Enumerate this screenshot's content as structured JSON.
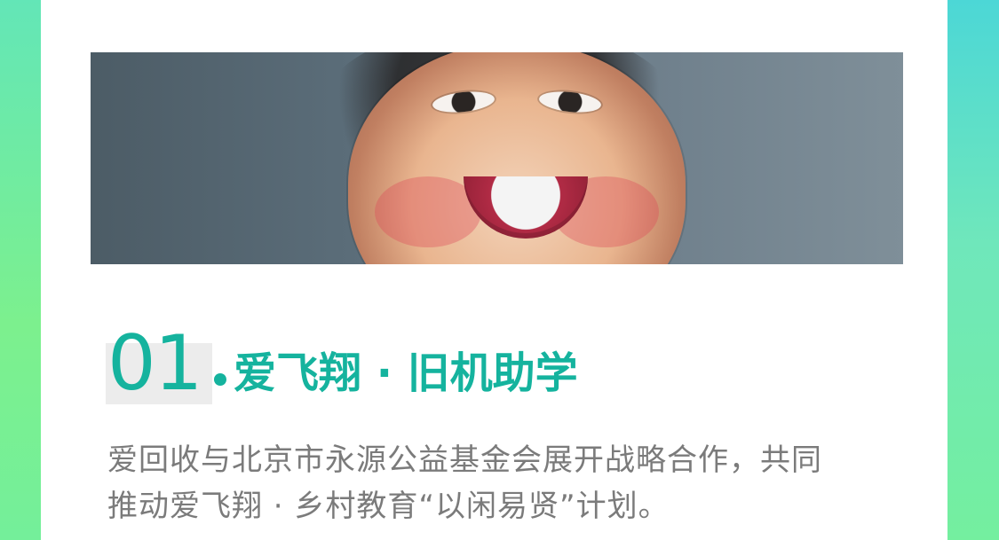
{
  "theme": {
    "accent": "#15b39e",
    "text_muted": "#7b7b7b",
    "card_bg": "#ffffff"
  },
  "hero": {
    "image_alt": ""
  },
  "section": {
    "number": "01",
    "title": "爱飞翔 · 旧机助学",
    "body_line_1": "爱回收与北京市永源公益基金会展开战略合作，共同",
    "body_line_2": "推动爱飞翔 · 乡村教育“以闲易贤”计划。"
  }
}
